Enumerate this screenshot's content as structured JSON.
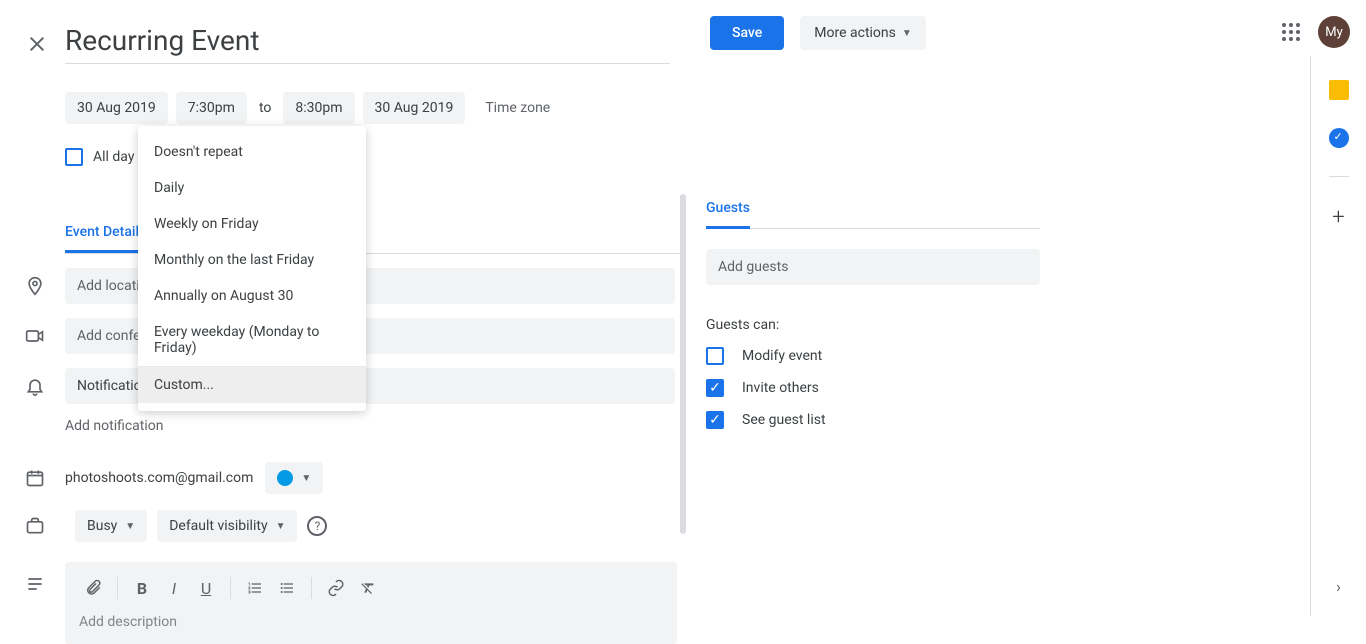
{
  "header": {
    "title": "Recurring Event",
    "save_label": "Save",
    "more_label": "More actions"
  },
  "datetime": {
    "start_date": "30 Aug 2019",
    "start_time": "7:30pm",
    "to_label": "to",
    "end_time": "8:30pm",
    "end_date": "30 Aug 2019",
    "timezone_label": "Time zone"
  },
  "allday": {
    "label": "All day"
  },
  "recurrence_options": [
    "Doesn't repeat",
    "Daily",
    "Weekly on Friday",
    "Monthly on the last Friday",
    "Annually on August 30",
    "Every weekday (Monday to Friday)",
    "Custom..."
  ],
  "tabs": {
    "details": "Event Details"
  },
  "details": {
    "location_placeholder": "Add location",
    "conference_placeholder": "Add conferencing",
    "notification_label": "Notification",
    "add_notification": "Add notification",
    "calendar_email": "photoshoots.com@gmail.com",
    "busy_label": "Busy",
    "visibility_label": "Default visibility",
    "description_placeholder": "Add description"
  },
  "guests": {
    "tab_label": "Guests",
    "input_placeholder": "Add guests",
    "can_label": "Guests can:",
    "perm_modify": "Modify event",
    "perm_invite": "Invite others",
    "perm_see": "See guest list"
  },
  "avatar_text": "My"
}
